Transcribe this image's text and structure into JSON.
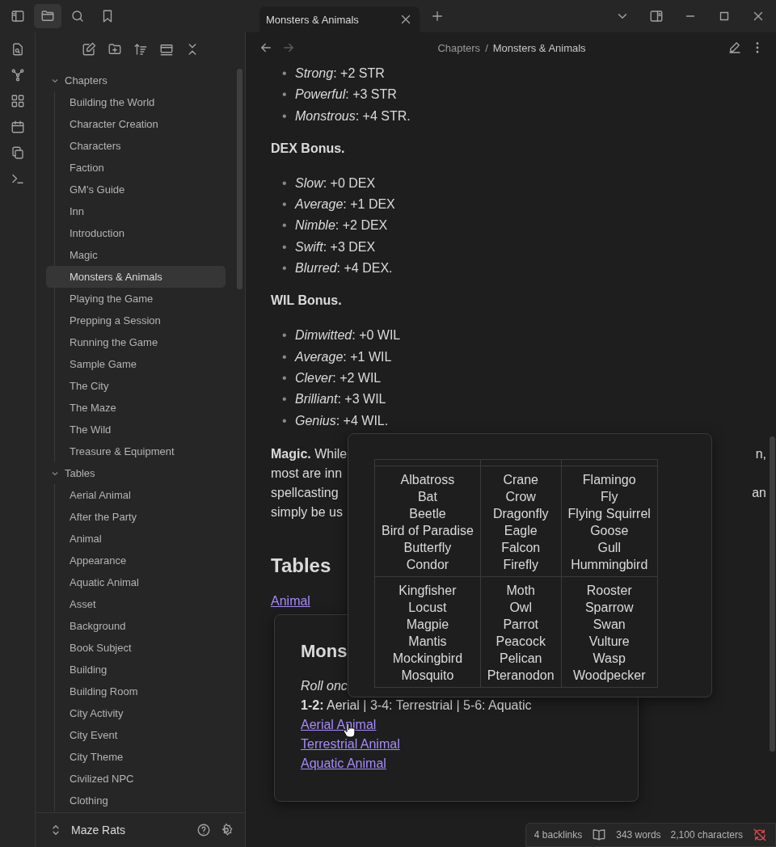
{
  "tabs": [
    {
      "label": "Monsters & Animals",
      "selected": true
    }
  ],
  "sidebar": {
    "folders": [
      {
        "label": "Chapters",
        "expanded": true,
        "children": [
          {
            "label": "Building the World",
            "selected": false
          },
          {
            "label": "Character Creation",
            "selected": false
          },
          {
            "label": "Characters",
            "selected": false
          },
          {
            "label": "Faction",
            "selected": false
          },
          {
            "label": "GM's Guide",
            "selected": false
          },
          {
            "label": "Inn",
            "selected": false
          },
          {
            "label": "Introduction",
            "selected": false
          },
          {
            "label": "Magic",
            "selected": false
          },
          {
            "label": "Monsters & Animals",
            "selected": true
          },
          {
            "label": "Playing the Game",
            "selected": false
          },
          {
            "label": "Prepping a Session",
            "selected": false
          },
          {
            "label": "Running the Game",
            "selected": false
          },
          {
            "label": "Sample Game",
            "selected": false
          },
          {
            "label": "The City",
            "selected": false
          },
          {
            "label": "The Maze",
            "selected": false
          },
          {
            "label": "The Wild",
            "selected": false
          },
          {
            "label": "Treasure & Equipment",
            "selected": false
          }
        ]
      },
      {
        "label": "Tables",
        "expanded": true,
        "children": [
          {
            "label": "Aerial Animal",
            "selected": false
          },
          {
            "label": "After the Party",
            "selected": false
          },
          {
            "label": "Animal",
            "selected": false
          },
          {
            "label": "Appearance",
            "selected": false
          },
          {
            "label": "Aquatic Animal",
            "selected": false
          },
          {
            "label": "Asset",
            "selected": false
          },
          {
            "label": "Background",
            "selected": false
          },
          {
            "label": "Book Subject",
            "selected": false
          },
          {
            "label": "Building",
            "selected": false
          },
          {
            "label": "Building Room",
            "selected": false
          },
          {
            "label": "City Activity",
            "selected": false
          },
          {
            "label": "City Event",
            "selected": false
          },
          {
            "label": "City Theme",
            "selected": false
          },
          {
            "label": "Civilized NPC",
            "selected": false
          },
          {
            "label": "Clothing",
            "selected": false
          }
        ]
      }
    ]
  },
  "vault": {
    "name": "Maze Rats"
  },
  "breadcrumb": {
    "items": [
      "Chapters",
      "Monsters & Animals"
    ],
    "separator": "/"
  },
  "document": {
    "blocks": [
      {
        "kind": "list",
        "marker": "•",
        "items": [
          "*Strong*: +2 STR",
          "*Powerful*: +3 STR",
          "*Monstrous*: +4 STR."
        ]
      },
      {
        "kind": "label",
        "text": "DEX Bonus."
      },
      {
        "kind": "list",
        "marker": "•",
        "items": [
          "*Slow*: +0 DEX",
          "*Average*: +1 DEX",
          "*Nimble*: +2 DEX",
          "*Swift*: +3 DEX",
          "*Blurred*: +4 DEX."
        ]
      },
      {
        "kind": "label",
        "text": "WIL Bonus."
      },
      {
        "kind": "list",
        "marker": "•",
        "items": [
          "*Dimwitted*: +0 WIL",
          "*Average*: +1 WIL",
          "*Clever*: +2 WIL",
          "*Brilliant*: +3 WIL",
          "*Genius*: +4 WIL."
        ]
      },
      {
        "kind": "fragments",
        "lines": [
          {
            "left": "**Magic.** While",
            "right": "n,"
          },
          {
            "left": "most are inn"
          },
          {
            "left": "spellcasting",
            "right": "an"
          },
          {
            "left": "simply be us"
          }
        ]
      },
      {
        "kind": "heading",
        "text": "Tables"
      },
      {
        "kind": "links",
        "items": [
          "Animal"
        ]
      }
    ]
  },
  "note_preview": {
    "heading": "Mons",
    "intro": "Roll onc",
    "roll": "**1-2:** Aerial | 3-4: Terrestrial | 5-6: Aquatic",
    "links": [
      "Aerial Animal",
      "Terrestrial Animal",
      "Aquatic Animal"
    ]
  },
  "table_preview": {
    "rows": [
      [
        "Albatross\nBat\nBeetle\nBird of Paradise\nButterfly\nCondor",
        "Crane\nCrow\nDragonfly\nEagle\nFalcon\nFirefly",
        "Flamingo\nFly\nFlying Squirrel\nGoose\nGull\nHummingbird"
      ],
      [
        "Kingfisher\nLocust\nMagpie\nMantis\nMockingbird\nMosquito",
        "Moth\nOwl\nParrot\nPeacock\nPelican\nPteranodon",
        "Rooster\nSparrow\nSwan\nVulture\nWasp\nWoodpecker"
      ]
    ]
  },
  "status_bar": {
    "backlinks": "4 backlinks",
    "words": "343 words",
    "characters": "2,100 characters"
  }
}
